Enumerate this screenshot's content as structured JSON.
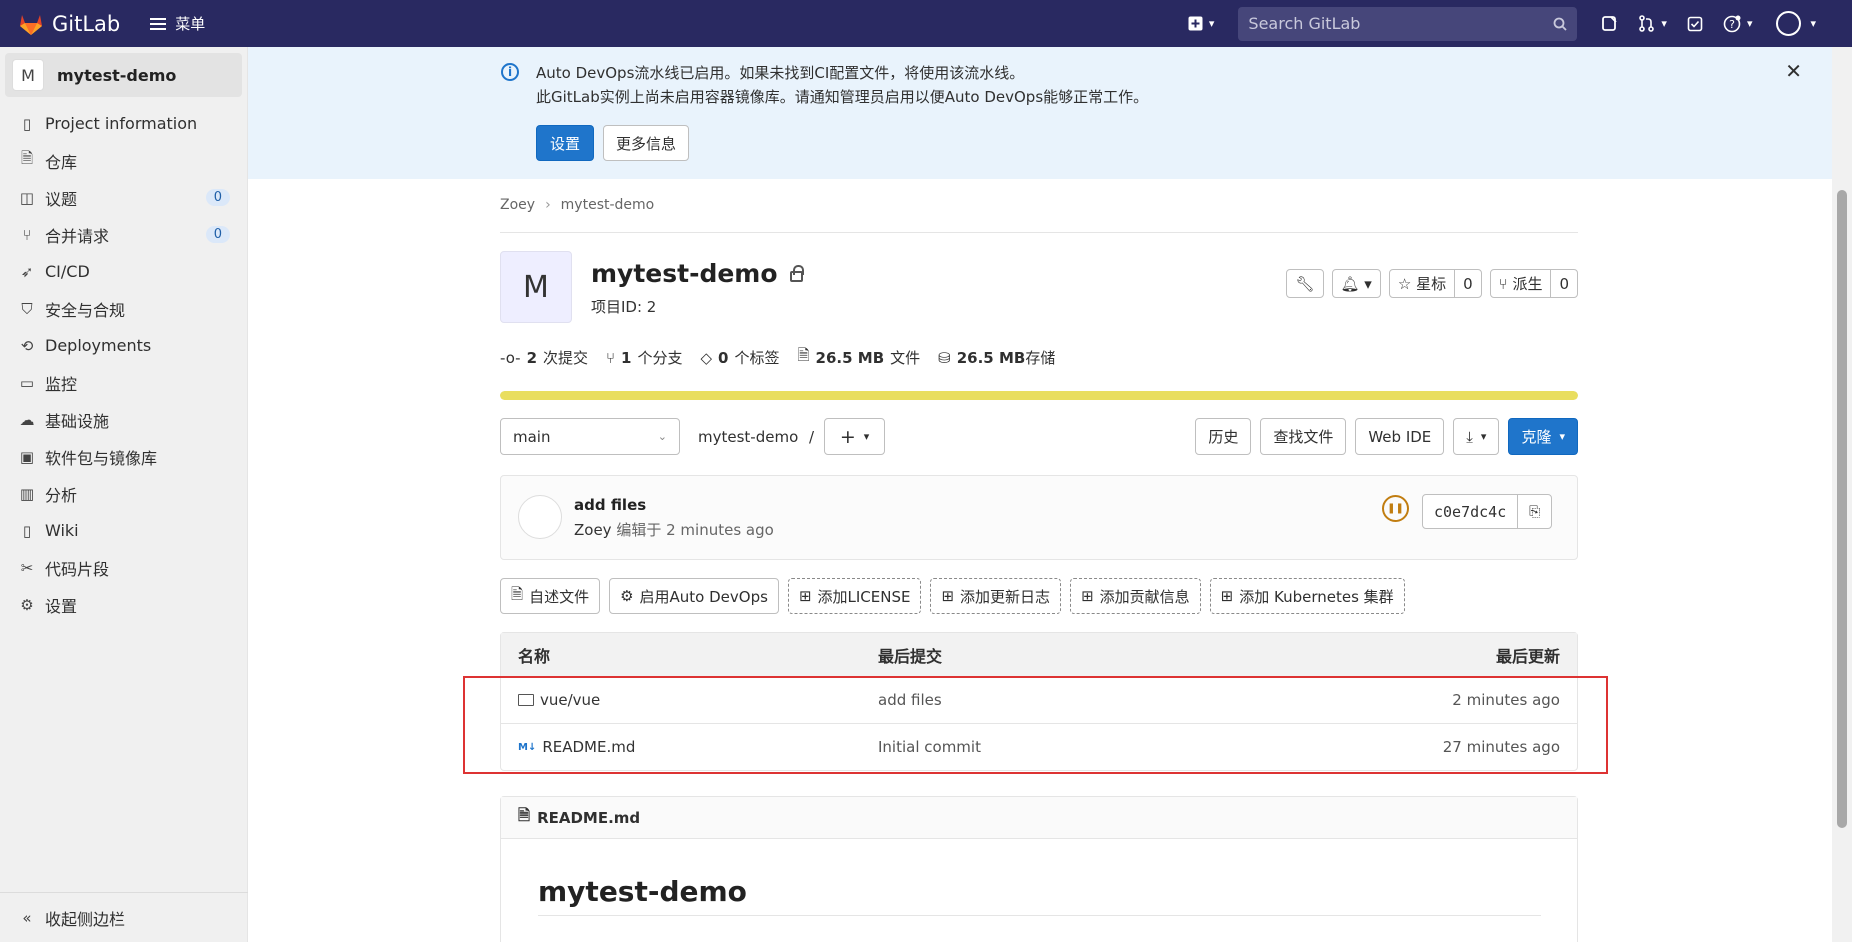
{
  "topbar": {
    "brand": "GitLab",
    "menu_label": "菜单",
    "search_placeholder": "Search GitLab"
  },
  "sidebar": {
    "project_avatar": "M",
    "project_name": "mytest-demo",
    "items": [
      {
        "label": "Project information",
        "icon": "info-doc-icon"
      },
      {
        "label": "仓库",
        "icon": "doc-icon"
      },
      {
        "label": "议题",
        "icon": "issues-icon",
        "badge": "0"
      },
      {
        "label": "合并请求",
        "icon": "merge-request-icon",
        "badge": "0"
      },
      {
        "label": "CI/CD",
        "icon": "rocket-icon"
      },
      {
        "label": "安全与合规",
        "icon": "shield-icon"
      },
      {
        "label": "Deployments",
        "icon": "deployments-icon"
      },
      {
        "label": "监控",
        "icon": "monitor-icon"
      },
      {
        "label": "基础设施",
        "icon": "cloud-icon"
      },
      {
        "label": "软件包与镜像库",
        "icon": "package-icon"
      },
      {
        "label": "分析",
        "icon": "chart-icon"
      },
      {
        "label": "Wiki",
        "icon": "book-icon"
      },
      {
        "label": "代码片段",
        "icon": "scissors-icon"
      },
      {
        "label": "设置",
        "icon": "gear-icon"
      }
    ],
    "collapse_label": "收起侧边栏"
  },
  "alert": {
    "line1": "Auto DevOps流水线已启用。如果未找到CI配置文件，将使用该流水线。",
    "line2": "此GitLab实例上尚未启用容器镜像库。请通知管理员启用以便Auto DevOps能够正常工作。",
    "primary_button": "设置",
    "secondary_button": "更多信息"
  },
  "breadcrumb": [
    "Zoey",
    "mytest-demo"
  ],
  "project": {
    "avatar": "M",
    "title": "mytest-demo",
    "id_label": "项目ID: 2",
    "star_label": "星标",
    "star_count": "0",
    "fork_label": "派生",
    "fork_count": "0"
  },
  "stats": {
    "commits_value": "2",
    "commits_label": "次提交",
    "branches_value": "1",
    "branches_label": "个分支",
    "tags_value": "0",
    "tags_label": "个标签",
    "files_value": "26.5 MB",
    "files_label": "文件",
    "storage_value": "26.5 MB",
    "storage_label": "存储"
  },
  "repo": {
    "branch": "main",
    "path": "mytest-demo",
    "path_sep": "/",
    "history": "历史",
    "find_file": "查找文件",
    "web_ide": "Web IDE",
    "clone": "克隆"
  },
  "commit": {
    "title": "add files",
    "author": "Zoey",
    "meta": "编辑于 2 minutes ago",
    "sha": "c0e7dc4c"
  },
  "quick_buttons": [
    "自述文件",
    "启用Auto DevOps",
    "添加LICENSE",
    "添加更新日志",
    "添加贡献信息",
    "添加 Kubernetes 集群"
  ],
  "file_table": {
    "headers": {
      "name": "名称",
      "last_commit": "最后提交",
      "last_update": "最后更新"
    },
    "rows": [
      {
        "name": "vue/vue",
        "commit": "add files",
        "time": "2 minutes ago",
        "type": "folder"
      },
      {
        "name": "README.md",
        "commit": "Initial commit",
        "time": "27 minutes ago",
        "type": "markdown"
      }
    ]
  },
  "readme": {
    "file_name": "README.md",
    "heading": "mytest-demo"
  },
  "colors": {
    "topbar": "#292961",
    "primary": "#1f75cb",
    "alert_bg": "#e9f3fc",
    "progress": "#e9de5f",
    "highlight": "#dd3333"
  },
  "language_bar_fill": 1
}
